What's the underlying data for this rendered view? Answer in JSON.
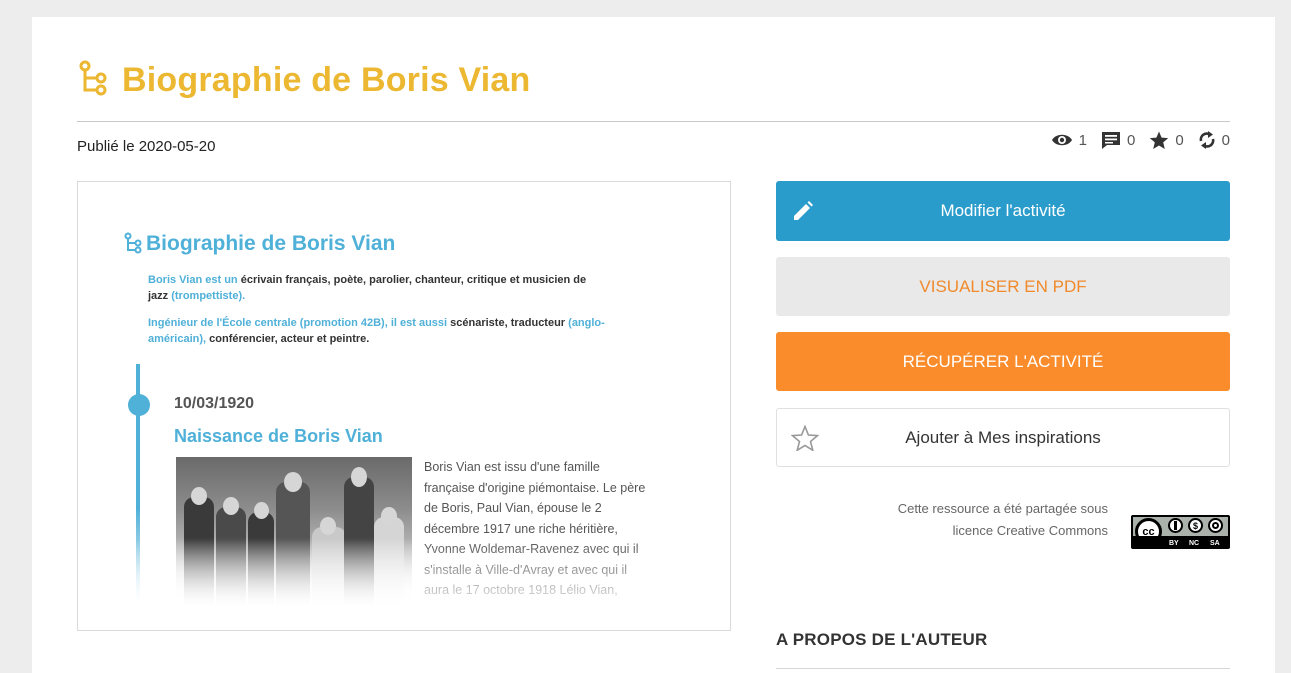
{
  "page": {
    "title": "Biographie de Boris Vian",
    "published": "Publié le 2020-05-20",
    "title_color": "#ecb731"
  },
  "stats": [
    {
      "icon": "eye-icon",
      "value": "1"
    },
    {
      "icon": "comment-icon",
      "value": "0"
    },
    {
      "icon": "star-icon",
      "value": "0"
    },
    {
      "icon": "refresh-icon",
      "value": "0"
    }
  ],
  "preview": {
    "title": "Biographie de Boris Vian",
    "para1_hl": "Boris Vian est un",
    "para1_text": " écrivain français, poète, parolier, chanteur, critique et musicien de jazz ",
    "para1_hl2": "(trompettiste).",
    "para2_hl": "Ingénieur de l'École centrale (promotion 42B), il est aussi",
    "para2_text": " scénariste, traducteur ",
    "para2_hl2": "(anglo-américain),",
    "para2_text2": " conférencier, acteur et peintre.",
    "event_date": "10/03/1920",
    "event_title": "Naissance de Boris Vian",
    "event_text": "Boris Vian est issu d'une famille française d'origine piémontaise. Le père de Boris, Paul Vian, épouse le 2 décembre 1917 une riche héritière, Yvonne Woldemar-Ravenez avec qui il s'installe à Ville-d'Avray et avec qui il aura le 17 octobre 1918 Lélio Vian,",
    "accent": "#4fb0d8"
  },
  "actions": {
    "edit": "Modifier l'activité",
    "pdf": "VISUALISER EN PDF",
    "get": "RÉCUPÉRER L'ACTIVITÉ",
    "inspiration": "Ajouter à Mes inspirations",
    "edit_color": "#2a9ccb",
    "get_color": "#fb8c2c"
  },
  "license": {
    "text": "Cette ressource a été partagée sous licence Creative Commons",
    "badge_cc": "cc",
    "badge_by": "BY",
    "badge_nc": "NC",
    "badge_sa": "SA"
  },
  "about": {
    "title": "A PROPOS DE L'AUTEUR"
  }
}
